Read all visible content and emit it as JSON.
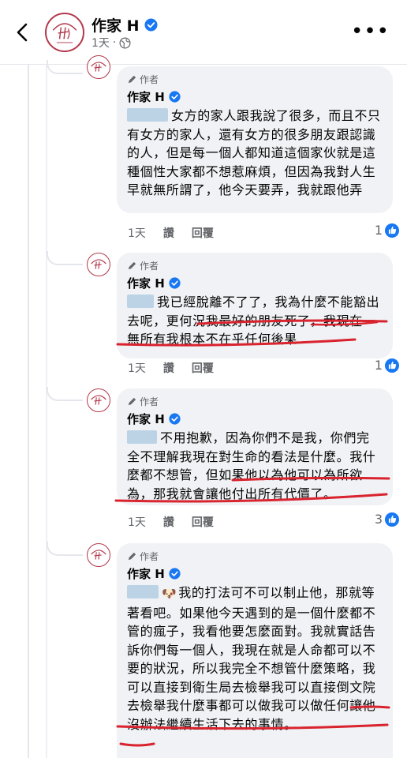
{
  "header": {
    "name": "作家 H",
    "time": "1天",
    "separator": "·",
    "more_label": "•••"
  },
  "comments": [
    {
      "badge": "作者",
      "name": "作家 H",
      "text": "女方的家人跟我說了很多，而且不只有女方的家人，還有女方的很多朋友跟認識的人，但是每一個人都知道這個家伙就是這種個性大家都不想惹麻煩，但因為我對人生早就無所謂了，他今天要弄，我就跟他弄",
      "time": "1天",
      "read": "讚",
      "reply": "回覆",
      "reactions": "1"
    },
    {
      "badge": "作者",
      "name": "作家 H",
      "text": "我已經脫離不了了，我為什麼不能豁出去呢，更何況我最好的朋友死了，我現在一無所有我根本不在乎任何後果",
      "time": "1天",
      "read": "讚",
      "reply": "回覆",
      "reactions": "1"
    },
    {
      "badge": "作者",
      "name": "作家 H",
      "text": "不用抱歉，因為你們不是我，你們完全不理解我現在對生命的看法是什麼。我什麼都不想管，但如果他以為他可以為所欲為，那我就會讓他付出所有代價了。",
      "time": "1天",
      "read": "讚",
      "reply": "回覆",
      "reactions": "3"
    },
    {
      "badge": "作者",
      "name": "作家 H",
      "emoji": "🐶",
      "text": "我的打法可不可以制止他，那就等著看吧。如果他今天遇到的是一個什麼都不管的瘋子，我看他要怎麼面對。我就實話告訴你們每一個人，我現在就是人命都可以不要的狀況，所以我完全不想管什麼策略，我可以直接到衛生局去檢舉我可以直接倒文院去檢舉我什麼事都可以做我可以做任何讓他沒辦法繼續生活下去的事情。"
    }
  ],
  "colors": {
    "verified": "#1877f2",
    "underline": "#d9232e",
    "bubble": "#f0f2f5",
    "avatar_ring": "#b3384a"
  }
}
